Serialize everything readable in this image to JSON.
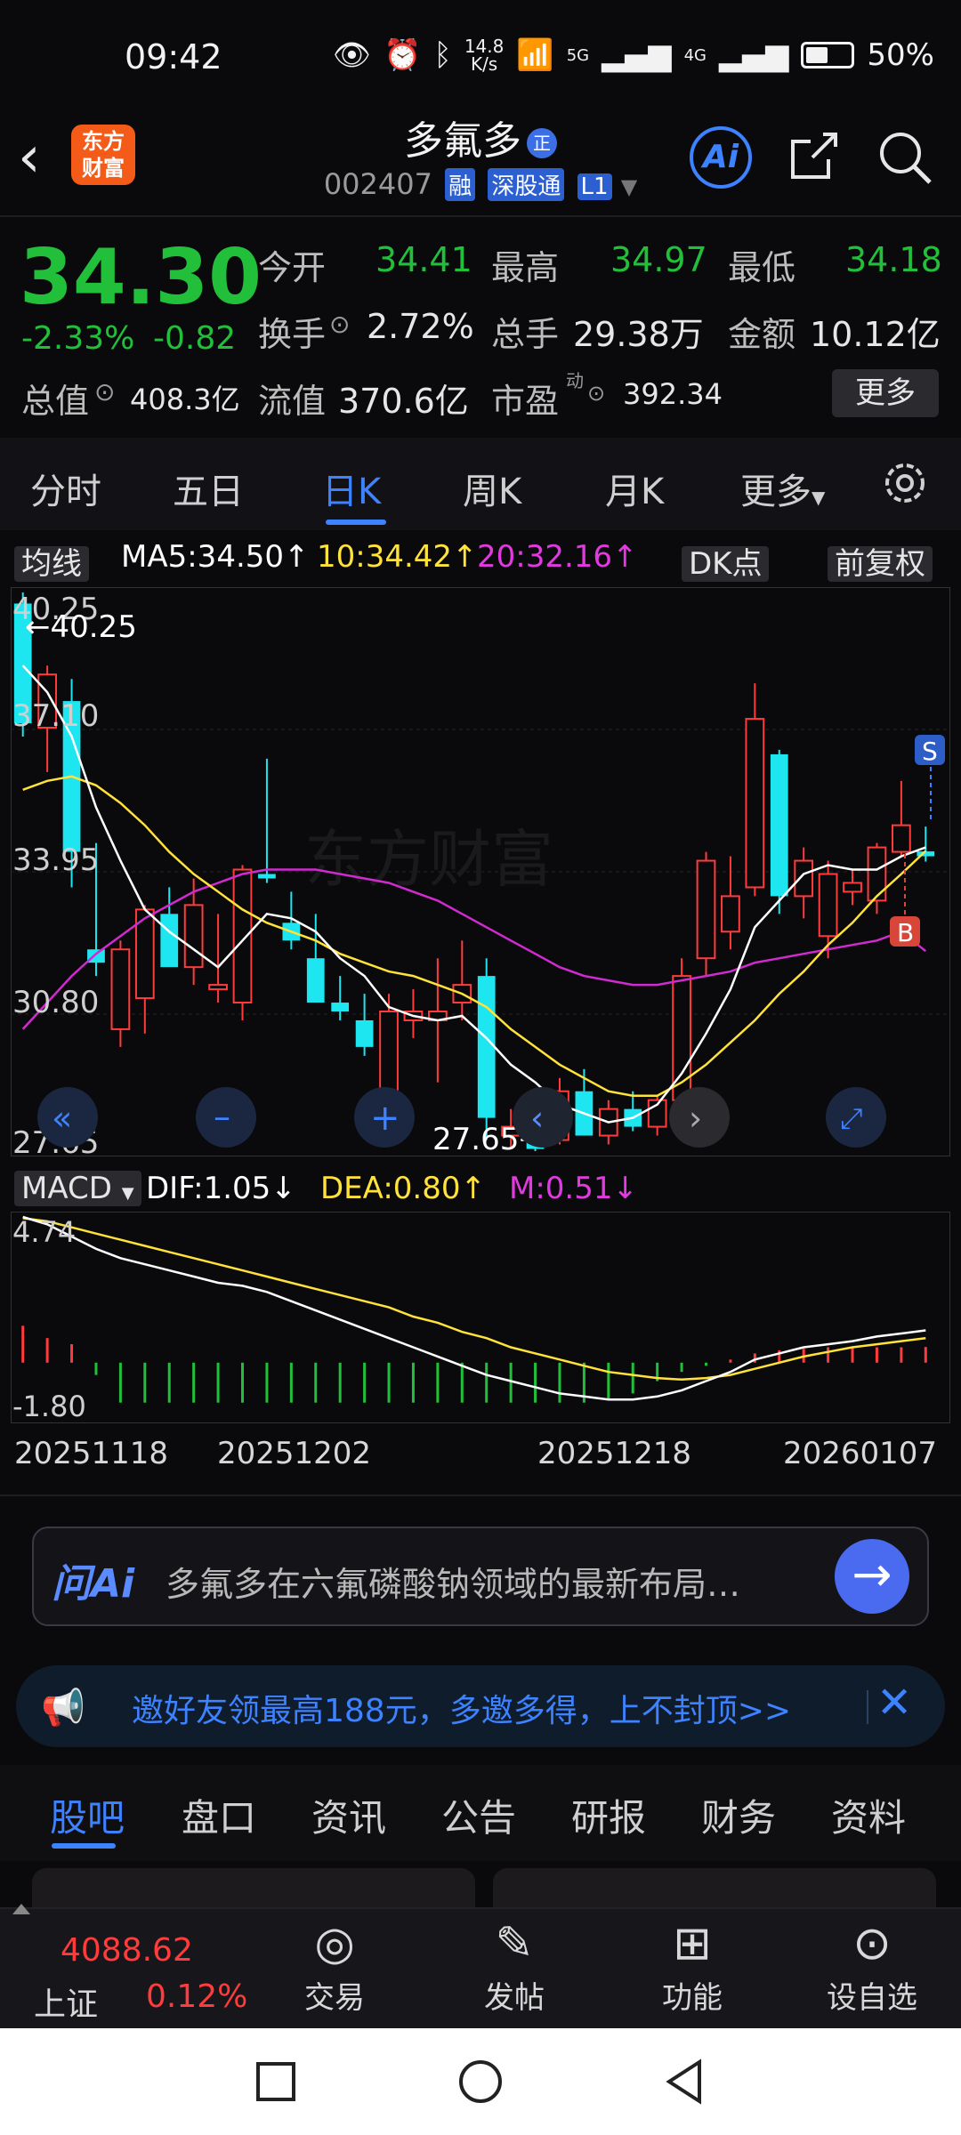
{
  "status_bar": {
    "time": "09:42",
    "net_speed_value": "14.8",
    "net_speed_unit": "K/s",
    "sig1": "5G",
    "sig2": "4G",
    "battery": "50%"
  },
  "header": {
    "logo_line1": "东方",
    "logo_line2": "财富",
    "stock_name": "多氟多",
    "badge": "正",
    "stock_code": "002407",
    "tags": [
      "融",
      "深股通",
      "L1"
    ],
    "ai_label": "Ai"
  },
  "quote": {
    "price": "34.30",
    "change_pct": "-2.33%",
    "change": "-0.82",
    "open_label": "今开",
    "open": "34.41",
    "high_label": "最高",
    "high": "34.97",
    "low_label": "最低",
    "low": "34.18",
    "turnover_label": "换手",
    "turnover": "2.72%",
    "volume_label": "总手",
    "volume": "29.38万",
    "amount_label": "金额",
    "amount": "10.12亿",
    "mcap_label": "总值",
    "mcap": "408.3亿",
    "float_label": "流值",
    "float": "370.6亿",
    "pe_label": "市盈",
    "pe_sup": "动",
    "pe": "392.34",
    "more": "更多"
  },
  "tabs": [
    "分时",
    "五日",
    "日K",
    "周K",
    "月K",
    "更多"
  ],
  "ma_bar": {
    "label": "均线",
    "ma5": "MA5:34.50",
    "ma10": "10:34.42",
    "ma20": "20:32.16",
    "dk": "DK点",
    "adj": "前复权"
  },
  "kchart_labels": {
    "y_top": "40.25",
    "y1": "37.10",
    "y2": "33.95",
    "y3": "30.80",
    "y_bottom": "27.65",
    "max_mark": "←40.25",
    "min_mark": "27.65→",
    "s_mark": "S",
    "b_mark": "B",
    "watermark": "东方财富"
  },
  "macd_bar": {
    "label": "MACD",
    "dif": "DIF:1.05",
    "dea": "DEA:0.80",
    "m": "M:0.51",
    "y_top": "4.74",
    "y_bottom": "-1.80"
  },
  "dates": [
    "20251118",
    "20251202",
    "20251218",
    "20260107"
  ],
  "ai_prompt": {
    "tag": "问Ai",
    "text": "多氟多在六氟磷酸钠领域的最新布局…"
  },
  "promo": {
    "text": "邀好友领最高188元，多邀多得，上不封顶>>"
  },
  "bottom_tabs": [
    "股吧",
    "盘口",
    "资讯",
    "公告",
    "研报",
    "财务",
    "资料"
  ],
  "bottom_nav": {
    "index_value": "4088.62",
    "index_name": "上证",
    "index_pct": "0.12%",
    "items": [
      "交易",
      "发帖",
      "功能",
      "设自选"
    ]
  },
  "colors": {
    "up": "#ff3b3b",
    "down": "#22c03a",
    "bear_candle": "#1ee6f0",
    "accent": "#3d82ff",
    "ma5": "#ffffff",
    "ma10": "#ffe23a",
    "ma20": "#d02ad0"
  },
  "chart_data": {
    "type": "candlestick",
    "ylim": [
      27.65,
      40.25
    ],
    "candles": [
      {
        "o": 40.0,
        "h": 40.25,
        "l": 37.0,
        "c": 37.3
      },
      {
        "o": 37.2,
        "h": 38.6,
        "l": 36.2,
        "c": 38.4
      },
      {
        "o": 37.8,
        "h": 38.3,
        "l": 33.6,
        "c": 34.4
      },
      {
        "o": 32.2,
        "h": 34.6,
        "l": 31.6,
        "c": 31.9
      },
      {
        "o": 30.4,
        "h": 32.4,
        "l": 30.0,
        "c": 32.2
      },
      {
        "o": 31.1,
        "h": 33.2,
        "l": 30.3,
        "c": 33.1
      },
      {
        "o": 33.0,
        "h": 33.6,
        "l": 32.4,
        "c": 31.8
      },
      {
        "o": 31.8,
        "h": 33.8,
        "l": 31.4,
        "c": 33.2
      },
      {
        "o": 31.3,
        "h": 33.0,
        "l": 31.0,
        "c": 31.4
      },
      {
        "o": 31.0,
        "h": 34.1,
        "l": 30.6,
        "c": 34.0
      },
      {
        "o": 33.9,
        "h": 36.5,
        "l": 33.7,
        "c": 33.8
      },
      {
        "o": 32.8,
        "h": 33.5,
        "l": 32.2,
        "c": 32.4
      },
      {
        "o": 32.0,
        "h": 33.0,
        "l": 31.0,
        "c": 31.0
      },
      {
        "o": 31.0,
        "h": 31.6,
        "l": 30.6,
        "c": 30.8
      },
      {
        "o": 30.6,
        "h": 31.2,
        "l": 29.8,
        "c": 30.0
      },
      {
        "o": 28.6,
        "h": 31.2,
        "l": 28.3,
        "c": 30.8
      },
      {
        "o": 30.6,
        "h": 31.3,
        "l": 30.2,
        "c": 30.8
      },
      {
        "o": 30.6,
        "h": 32.0,
        "l": 29.2,
        "c": 30.8
      },
      {
        "o": 31.0,
        "h": 32.4,
        "l": 30.6,
        "c": 31.4
      },
      {
        "o": 31.6,
        "h": 32.0,
        "l": 27.9,
        "c": 28.4
      },
      {
        "o": 28.0,
        "h": 28.6,
        "l": 27.7,
        "c": 28.2
      },
      {
        "o": 28.2,
        "h": 28.5,
        "l": 27.65,
        "c": 27.7
      },
      {
        "o": 27.9,
        "h": 29.3,
        "l": 27.8,
        "c": 29.0
      },
      {
        "o": 29.0,
        "h": 29.5,
        "l": 28.7,
        "c": 28.0
      },
      {
        "o": 28.0,
        "h": 28.8,
        "l": 27.8,
        "c": 28.6
      },
      {
        "o": 28.6,
        "h": 29.0,
        "l": 28.1,
        "c": 28.2
      },
      {
        "o": 28.2,
        "h": 28.9,
        "l": 28.0,
        "c": 28.8
      },
      {
        "o": 28.8,
        "h": 32.0,
        "l": 28.7,
        "c": 31.6
      },
      {
        "o": 32.0,
        "h": 34.4,
        "l": 31.6,
        "c": 34.2
      },
      {
        "o": 32.6,
        "h": 34.3,
        "l": 32.2,
        "c": 33.4
      },
      {
        "o": 33.6,
        "h": 38.2,
        "l": 33.4,
        "c": 37.4
      },
      {
        "o": 36.6,
        "h": 36.7,
        "l": 33.0,
        "c": 33.4
      },
      {
        "o": 33.4,
        "h": 34.5,
        "l": 32.9,
        "c": 34.2
      },
      {
        "o": 32.5,
        "h": 34.2,
        "l": 32.0,
        "c": 33.9
      },
      {
        "o": 33.5,
        "h": 34.0,
        "l": 33.2,
        "c": 33.7
      },
      {
        "o": 33.3,
        "h": 34.6,
        "l": 33.0,
        "c": 34.5
      },
      {
        "o": 34.4,
        "h": 36.0,
        "l": 34.3,
        "c": 35.0
      },
      {
        "o": 34.41,
        "h": 34.97,
        "l": 34.18,
        "c": 34.3
      }
    ],
    "ma5": [
      38.6,
      38.0,
      37.0,
      35.4,
      34.2,
      33.1,
      32.6,
      32.2,
      31.8,
      32.4,
      33.0,
      32.9,
      32.6,
      32.0,
      31.6,
      30.9,
      30.7,
      30.6,
      30.7,
      30.2,
      29.6,
      29.2,
      28.7,
      28.5,
      28.3,
      28.4,
      28.7,
      29.4,
      30.3,
      31.3,
      32.7,
      33.3,
      33.9,
      34.1,
      34.0,
      34.0,
      34.3,
      34.5
    ],
    "ma10": [
      35.8,
      36.0,
      36.1,
      35.9,
      35.5,
      35.0,
      34.4,
      33.9,
      33.5,
      33.1,
      32.8,
      32.6,
      32.4,
      32.1,
      31.9,
      31.7,
      31.6,
      31.4,
      31.2,
      30.9,
      30.4,
      30.0,
      29.6,
      29.3,
      29.0,
      28.9,
      28.9,
      29.2,
      29.6,
      30.1,
      30.6,
      31.2,
      31.7,
      32.3,
      32.8,
      33.4,
      33.9,
      34.42
    ],
    "ma20": [
      30.4,
      31.0,
      31.6,
      32.1,
      32.5,
      32.9,
      33.2,
      33.5,
      33.7,
      33.9,
      34.0,
      34.0,
      34.0,
      33.9,
      33.8,
      33.7,
      33.5,
      33.3,
      33.0,
      32.7,
      32.4,
      32.1,
      31.8,
      31.6,
      31.5,
      31.4,
      31.4,
      31.5,
      31.6,
      31.7,
      31.9,
      32.0,
      32.1,
      32.2,
      32.3,
      32.4,
      32.6,
      32.16
    ],
    "macd": {
      "ylim": [
        -1.8,
        4.74
      ],
      "dif": [
        4.74,
        4.5,
        4.1,
        3.7,
        3.4,
        3.2,
        3.0,
        2.8,
        2.6,
        2.5,
        2.3,
        2.0,
        1.7,
        1.4,
        1.1,
        0.8,
        0.5,
        0.2,
        -0.1,
        -0.4,
        -0.6,
        -0.8,
        -1.0,
        -1.1,
        -1.2,
        -1.2,
        -1.1,
        -0.9,
        -0.6,
        -0.3,
        0.1,
        0.3,
        0.5,
        0.6,
        0.7,
        0.85,
        0.95,
        1.05
      ],
      "dea": [
        4.7,
        4.6,
        4.4,
        4.2,
        4.0,
        3.8,
        3.6,
        3.4,
        3.2,
        3.0,
        2.8,
        2.6,
        2.4,
        2.2,
        2.0,
        1.8,
        1.5,
        1.3,
        1.0,
        0.8,
        0.5,
        0.3,
        0.1,
        -0.1,
        -0.3,
        -0.4,
        -0.5,
        -0.55,
        -0.5,
        -0.4,
        -0.2,
        0.0,
        0.2,
        0.35,
        0.5,
        0.6,
        0.7,
        0.8
      ],
      "m": [
        1.2,
        0.8,
        0.6,
        -0.4,
        -1.3,
        -1.3,
        -1.3,
        -1.3,
        -1.3,
        -1.3,
        -1.3,
        -1.3,
        -1.3,
        -1.3,
        -1.3,
        -1.3,
        -1.3,
        -1.3,
        -1.3,
        -1.3,
        -1.3,
        -1.3,
        -1.3,
        -1.3,
        -1.2,
        -1.0,
        -0.6,
        -0.3,
        -0.1,
        0.1,
        0.3,
        0.4,
        0.45,
        0.5,
        0.5,
        0.5,
        0.5,
        0.51
      ]
    }
  }
}
